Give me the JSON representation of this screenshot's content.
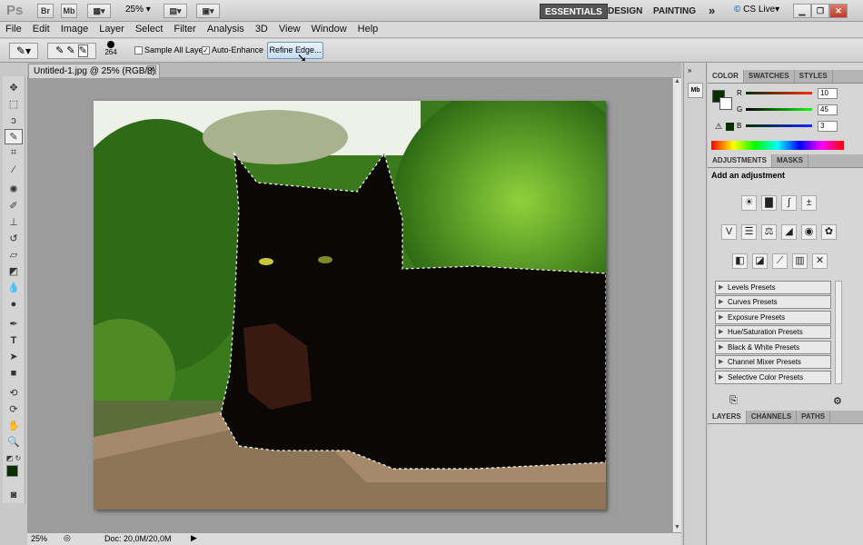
{
  "appbar": {
    "logo": "Ps",
    "btn_bridge": "Br",
    "btn_mini": "Mb",
    "zoom": "25%",
    "workspaces": [
      "ESSENTIALS",
      "DESIGN",
      "PAINTING"
    ],
    "more": "»",
    "cslive": "CS Live"
  },
  "menu": [
    "File",
    "Edit",
    "Image",
    "Layer",
    "Select",
    "Filter",
    "Analysis",
    "3D",
    "View",
    "Window",
    "Help"
  ],
  "options": {
    "brush_size": "264",
    "sample_all": "Sample All Layers",
    "auto_enhance": "Auto-Enhance",
    "refine_edge": "Refine Edge..."
  },
  "document": {
    "tab_title": "Untitled-1.jpg @ 25% (RGB/8) *",
    "zoom": "25%",
    "doc_info": "Doc: 20,0M/20,0M"
  },
  "color_panel": {
    "tabs": [
      "COLOR",
      "SWATCHES",
      "STYLES"
    ],
    "r_label": "R",
    "g_label": "G",
    "b_label": "B",
    "r": "10",
    "g": "45",
    "b": "3",
    "fg_color": "#0a2d03"
  },
  "adjust_panel": {
    "tabs": [
      "ADJUSTMENTS",
      "MASKS"
    ],
    "heading": "Add an adjustment",
    "presets": [
      "Levels Presets",
      "Curves Presets",
      "Exposure Presets",
      "Hue/Saturation Presets",
      "Black & White Presets",
      "Channel Mixer Presets",
      "Selective Color Presets"
    ]
  },
  "layers_panel": {
    "tabs": [
      "LAYERS",
      "CHANNELS",
      "PATHS"
    ]
  }
}
